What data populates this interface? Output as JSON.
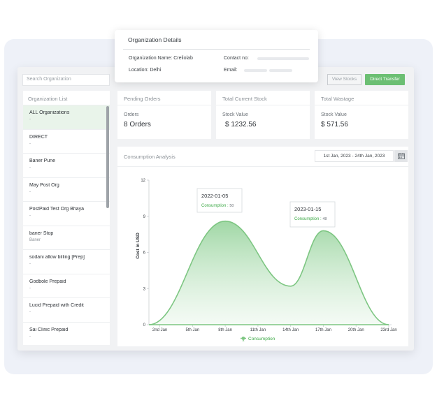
{
  "search": {
    "placeholder": "Search Organization"
  },
  "org_list": {
    "title": "Organization List",
    "items": [
      {
        "name": "ALL Organizations",
        "sub": "-"
      },
      {
        "name": "DIRECT",
        "sub": "-"
      },
      {
        "name": "Baner Pune",
        "sub": "-"
      },
      {
        "name": "May Post Org",
        "sub": "-"
      },
      {
        "name": "PostPaid Test Org Bhaya",
        "sub": "-"
      },
      {
        "name": "baner Stop",
        "sub": "Baner"
      },
      {
        "name": "sodani allow billing [Prep]",
        "sub": "-"
      },
      {
        "name": "Godbole Prepaid",
        "sub": "-"
      },
      {
        "name": "Lucid Prepaid with Credit",
        "sub": "-"
      },
      {
        "name": "Sai Clinic Prepaid",
        "sub": "-"
      }
    ]
  },
  "toolbar": {
    "view_stocks": "View Stocks",
    "direct_transfer": "Direct Transfer"
  },
  "cards": {
    "pending": {
      "title": "Pending Orders",
      "label": "Orders",
      "value": "8 Orders"
    },
    "stock": {
      "title": "Total Current Stock",
      "label": "Stock Value",
      "value": "$ 1232.56"
    },
    "wastage": {
      "title": "Total Wastage",
      "label": "Stock Value",
      "value": "$ 571.56"
    }
  },
  "analysis": {
    "title": "Consumption Analysis",
    "date_range": "1st Jan, 2023 - 24th Jan, 2023",
    "legend_label": "Consumption"
  },
  "details": {
    "title": "Organization Details",
    "org_name_label": "Organization Name:",
    "org_name": "Creliolab",
    "location_label": "Location:",
    "location": "Delhi",
    "contact_label": "Contact no:",
    "email_label": "Email:"
  },
  "colors": {
    "accent": "#6cbf73",
    "line": "#7dc682",
    "tooltip_green": "#3aa844"
  },
  "chart_data": {
    "type": "area",
    "ylabel": "Cost in USD",
    "xlabel": "",
    "ylim": [
      0,
      12
    ],
    "y_ticks": [
      0,
      3,
      6,
      9,
      12
    ],
    "x_ticks": [
      "2nd Jan",
      "5th Jan",
      "8th Jan",
      "11th Jan",
      "14th Jan",
      "17th Jan",
      "20th Jan",
      "23rd Jan"
    ],
    "grid": false,
    "legend": "bottom-center",
    "series": [
      {
        "name": "Consumption",
        "points": [
          {
            "x": "1st Jan",
            "y": 0
          },
          {
            "x": "8th Jan",
            "y": 8.6
          },
          {
            "x": "14th Jan",
            "y": 3.2
          },
          {
            "x": "17th Jan",
            "y": 7.8
          },
          {
            "x": "23rd Jan",
            "y": 0
          }
        ]
      }
    ],
    "annotations": [
      {
        "date": "2022-01-05",
        "label": "Consumption :",
        "value": "50"
      },
      {
        "date": "2023-01-15",
        "label": "Consumption :",
        "value": "48"
      }
    ]
  }
}
